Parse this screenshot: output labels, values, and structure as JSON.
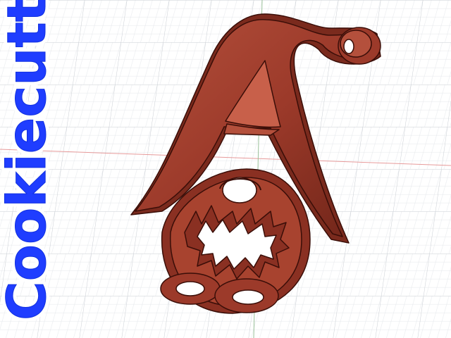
{
  "watermark": {
    "text": "Cookiecutter",
    "fill_color": "#1f3dff",
    "outline_color": "#ffffff"
  },
  "scene": {
    "background_color": "#ffffff",
    "grid_minor_color": "#e3e6ea",
    "grid_major_color": "#c9cdd3",
    "axis_x_color": "#e79a9a",
    "axis_y_color": "#9ac19a",
    "model": {
      "name": "cookie-cutter-model",
      "body_color": "#9c3a2a",
      "highlight_color": "#c8604a",
      "shadow_color": "#5e1d14",
      "outline_color": "#3a0e08"
    }
  }
}
